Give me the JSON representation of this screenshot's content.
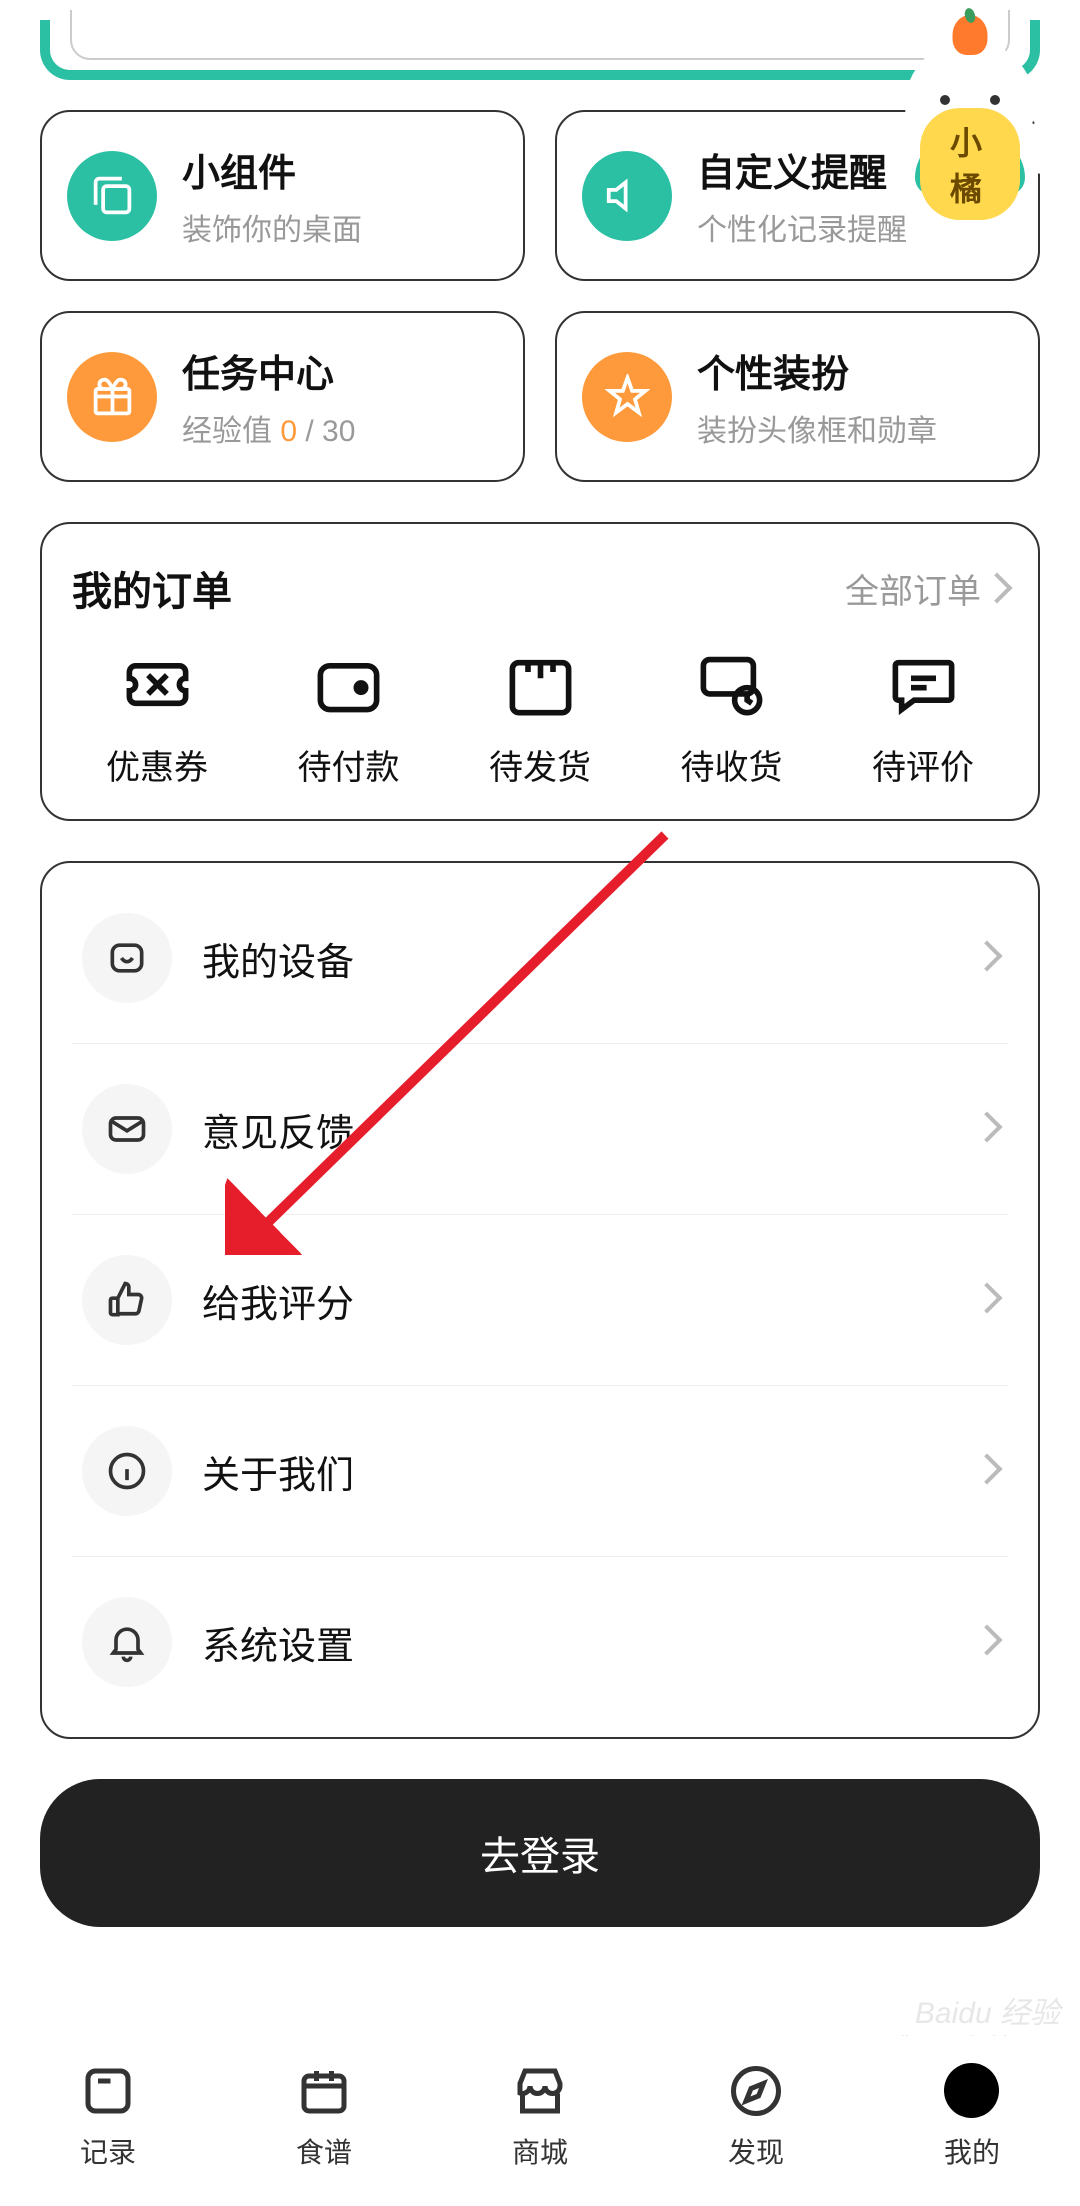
{
  "mascot": {
    "name": "小橘"
  },
  "cards": [
    {
      "title": "小组件",
      "sub": "装饰你的桌面"
    },
    {
      "title": "自定义提醒",
      "sub": "个性化记录提醒"
    },
    {
      "title": "任务中心",
      "exp_label": "经验值 ",
      "exp_current": "0",
      "exp_rest": " / 30"
    },
    {
      "title": "个性装扮",
      "sub": "装扮头像框和勋章"
    }
  ],
  "orders": {
    "title": "我的订单",
    "all": "全部订单",
    "items": [
      "优惠券",
      "待付款",
      "待发货",
      "待收货",
      "待评价"
    ]
  },
  "settings": [
    "我的设备",
    "意见反馈",
    "给我评分",
    "关于我们",
    "系统设置"
  ],
  "login_button": "去登录",
  "nav": [
    "记录",
    "食谱",
    "商城",
    "发现",
    "我的"
  ],
  "watermark": {
    "main": "Baidu 经验",
    "sub": "jingyan.baidu.com"
  }
}
